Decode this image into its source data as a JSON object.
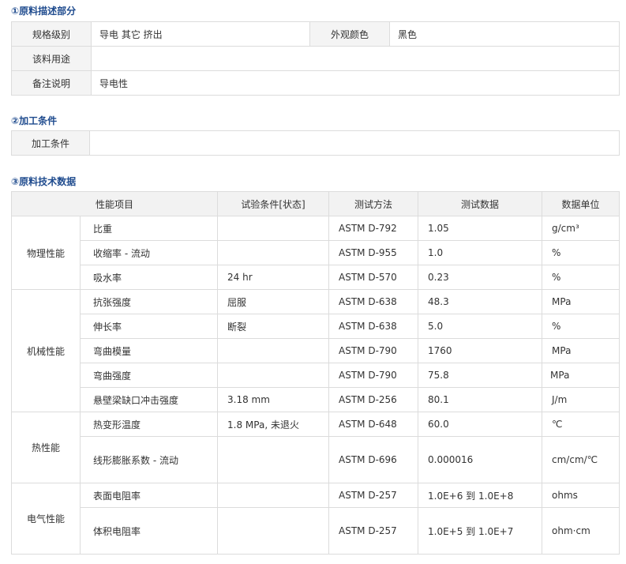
{
  "section1": {
    "title": "①原料描述部分",
    "rows": {
      "spec_label": "规格级别",
      "spec_value": "导电 其它 挤出",
      "color_label": "外观颜色",
      "color_value": "黑色",
      "usage_label": "该料用途",
      "usage_value": "",
      "note_label": "备注说明",
      "note_value": "导电性"
    }
  },
  "section2": {
    "title": "②加工条件",
    "label": "加工条件",
    "value": ""
  },
  "section3": {
    "title": "③原料技术数据",
    "headers": [
      "性能项目",
      "试验条件[状态]",
      "测试方法",
      "测试数据",
      "数据单位"
    ],
    "groups": [
      {
        "name": "物理性能",
        "rows": [
          {
            "item": "比重",
            "cond": "",
            "method": "ASTM D-792",
            "value": "1.05",
            "unit": "g/cm³"
          },
          {
            "item": "收缩率 - 流动",
            "cond": "",
            "method": "ASTM D-955",
            "value": "1.0",
            "unit": "%"
          },
          {
            "item": "吸水率",
            "cond": "24 hr",
            "method": "ASTM D-570",
            "value": "0.23",
            "unit": "%"
          }
        ]
      },
      {
        "name": "机械性能",
        "rows": [
          {
            "item": "抗张强度",
            "cond": "屈服",
            "method": "ASTM D-638",
            "value": "48.3",
            "unit": "MPa"
          },
          {
            "item": "伸长率",
            "cond": "断裂",
            "method": "ASTM D-638",
            "value": "5.0",
            "unit": "%"
          },
          {
            "item": "弯曲模量",
            "cond": "",
            "method": "ASTM D-790",
            "value": "1760",
            "unit": "MPa"
          },
          {
            "item": "弯曲强度",
            "cond": "",
            "method": "ASTM D-790",
            "value": "75.8",
            "unit": "MPa"
          },
          {
            "item": "悬壁梁缺口冲击强度",
            "cond": "3.18 mm",
            "method": "ASTM D-256",
            "value": "80.1",
            "unit": "J/m"
          }
        ]
      },
      {
        "name": "热性能",
        "rows": [
          {
            "item": "热变形温度",
            "cond": "1.8 MPa, 未退火",
            "method": "ASTM D-648",
            "value": "60.0",
            "unit": "℃"
          },
          {
            "item": "线形膨胀系数 - 流动",
            "cond": "",
            "method": "ASTM D-696",
            "value": "0.000016",
            "unit": "cm/cm/℃"
          }
        ]
      },
      {
        "name": "电气性能",
        "rows": [
          {
            "item": "表面电阻率",
            "cond": "",
            "method": "ASTM D-257",
            "value": "1.0E+6 到 1.0E+8",
            "unit": "ohms"
          },
          {
            "item": "体积电阻率",
            "cond": "",
            "method": "ASTM D-257",
            "value": "1.0E+5 到 1.0E+7",
            "unit": "ohm·cm"
          }
        ]
      }
    ]
  }
}
